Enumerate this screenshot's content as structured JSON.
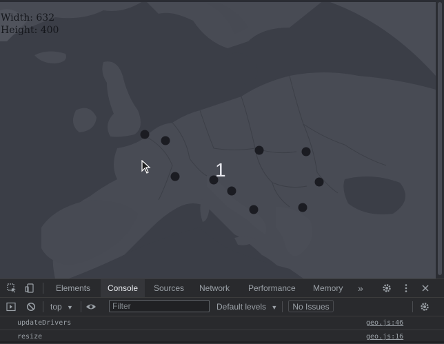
{
  "viewport": {
    "dimensions": {
      "width_label": "Width: 632",
      "height_label": "Height: 400"
    },
    "cluster_count": "1",
    "markers": [
      {
        "name": "marker-london"
      },
      {
        "name": "marker-brussels"
      },
      {
        "name": "marker-lyon"
      },
      {
        "name": "marker-milan"
      },
      {
        "name": "marker-bologna"
      },
      {
        "name": "marker-rome"
      },
      {
        "name": "marker-vienna"
      },
      {
        "name": "marker-budapest"
      },
      {
        "name": "marker-belgrade"
      },
      {
        "name": "marker-skopje"
      }
    ]
  },
  "devtools": {
    "tabs": [
      "Elements",
      "Console",
      "Sources",
      "Network",
      "Performance",
      "Memory"
    ],
    "active_tab": "Console",
    "more_tabs": "»",
    "toolbar": {
      "context": "top",
      "filter_placeholder": "Filter",
      "levels": "Default levels",
      "issues": "No Issues"
    },
    "logs": [
      {
        "message": "updateDrivers",
        "source": "geo.js:46"
      },
      {
        "message": "resize",
        "source": "geo.js:16"
      }
    ]
  }
}
